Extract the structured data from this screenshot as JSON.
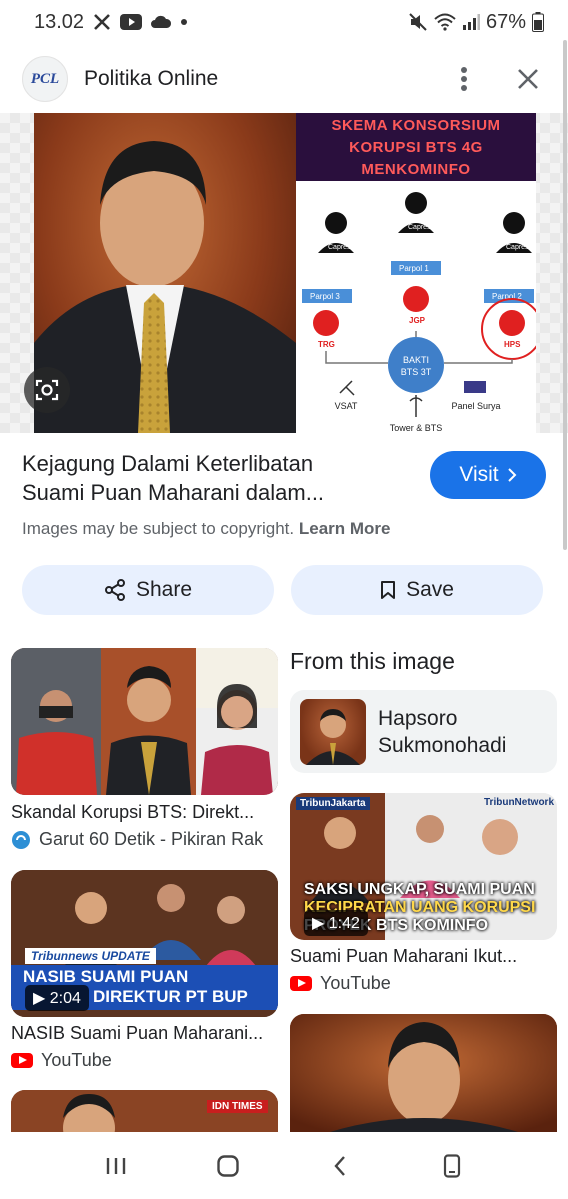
{
  "status_bar": {
    "time": "13.02",
    "battery": "67%"
  },
  "header": {
    "site_name": "Politika Online",
    "logo_text": "PCL"
  },
  "hero": {
    "diagram_title_lines": [
      "SKEMA KONSORSIUM",
      "KORUPSI BTS 4G",
      "MENKOMINFO"
    ],
    "diagram_labels": {
      "capres_left": "Capres",
      "capres_mid": "Capres",
      "capres_right": "Capres",
      "parpol1": "Parpol 1",
      "parpol2": "Parpol 2",
      "parpol3": "Parpol 3",
      "trg": "TRG",
      "jgp": "JGP",
      "hps": "HPS",
      "center_1": "BAKTI",
      "center_2": "BTS 3T",
      "vsat": "VSAT",
      "panel": "Panel Surya",
      "tower": "Tower & BTS"
    }
  },
  "result": {
    "title_line1": "Kejagung Dalami Keterlibatan",
    "title_line2": "Suami Puan Maharani dalam...",
    "visit_label": "Visit",
    "copyright_text": "Images may be subject to copyright.",
    "learn_more": "Learn More"
  },
  "actions": {
    "share_label": "Share",
    "save_label": "Save"
  },
  "from_image": {
    "heading": "From this image",
    "entity_line1": "Hapsoro",
    "entity_line2": "Sukmonohadi"
  },
  "results": [
    {
      "title": "Skandal Korupsi BTS: Direkt...",
      "source": "Garut 60 Detik - Pikiran Rak"
    },
    {
      "title": "NASIB Suami Puan Maharani...",
      "source": "YouTube",
      "duration": "2:04",
      "overlay_brand": "Tribunnews UPDATE",
      "overlay_line1": "NASIB SUAMI PUAN",
      "overlay_line2": "DIREKTUR PT BUP"
    },
    {
      "title": "Suami Puan Maharani Ikut...",
      "source": "YouTube",
      "duration": "1:42",
      "overlay_brand_left": "TribunJakarta",
      "overlay_brand_right": "TribunNetwork",
      "overlay_line1": "SAKSI UNGKAP, SUAMI PUAN",
      "overlay_line2": "KECIPRATAN UANG KORUPSI",
      "overlay_line3": "PROYEK BTS KOMINFO"
    },
    {
      "overlay_brand": "IDN TIMES"
    }
  ],
  "colors": {
    "accent": "#1a73e8",
    "pill": "#e8f0fe",
    "youtube": "#ff0000"
  }
}
